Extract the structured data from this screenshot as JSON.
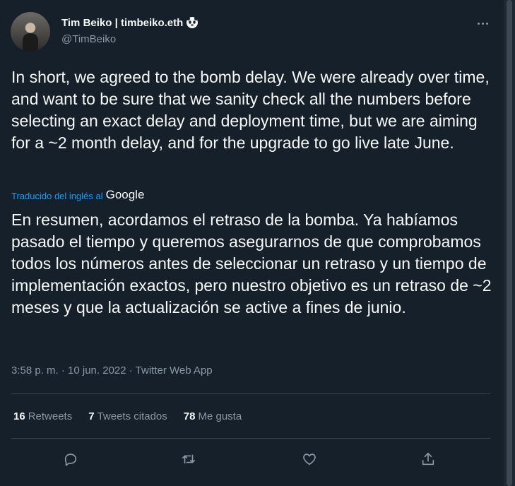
{
  "author": {
    "display_name": "Tim Beiko | timbeiko.eth",
    "handle": "@TimBeiko"
  },
  "tweet": {
    "text": "In short, we agreed to the bomb delay. We were already over time, and want to be sure that we sanity check all the numbers before selecting an exact delay and deployment time, but we are aiming for a ~2 month delay, and for the upgrade to go live late June.",
    "translated_label": "Traducido del inglés al",
    "translation_provider": "Google",
    "translation": "En resumen, acordamos el retraso de la bomba. Ya habíamos pasado el tiempo y queremos asegurarnos de que comprobamos todos los números antes de seleccionar un retraso y un tiempo de implementación exactos, pero nuestro objetivo es un retraso de ~2 meses y que la actualización se active a fines de junio.",
    "timestamp": "3:58 p. m. · 10 jun. 2022 · Twitter Web App"
  },
  "stats": {
    "retweets_count": "16",
    "retweets_label": "Retweets",
    "quotes_count": "7",
    "quotes_label": "Tweets citados",
    "likes_count": "78",
    "likes_label": "Me gusta"
  },
  "icons": [
    "panda-icon",
    "more-icon",
    "reply-icon",
    "retweet-icon",
    "like-icon",
    "share-icon"
  ],
  "colors": {
    "background": "#15202b",
    "text": "#f7f9f9",
    "secondary_text": "#8b98a5",
    "link": "#1d9bf0",
    "divider": "#38444d"
  }
}
